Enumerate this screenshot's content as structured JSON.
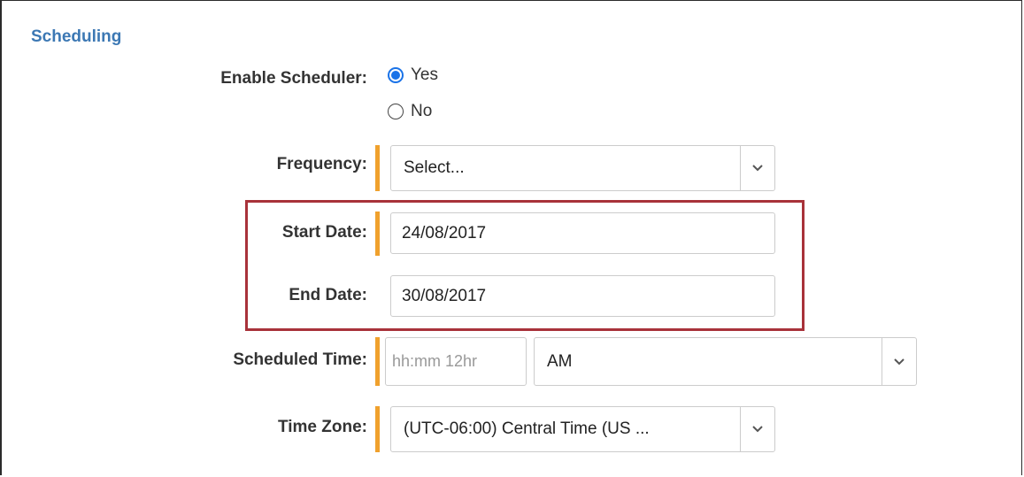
{
  "section": {
    "title": "Scheduling"
  },
  "enable_scheduler": {
    "label": "Enable Scheduler:",
    "options": [
      {
        "label": "Yes",
        "checked": true
      },
      {
        "label": "No",
        "checked": false
      }
    ]
  },
  "frequency": {
    "label": "Frequency:",
    "value": "Select..."
  },
  "start_date": {
    "label": "Start Date:",
    "value": "24/08/2017"
  },
  "end_date": {
    "label": "End Date:",
    "value": "30/08/2017"
  },
  "scheduled_time": {
    "label": "Scheduled Time:",
    "placeholder": "hh:mm 12hr",
    "ampm_value": "AM"
  },
  "time_zone": {
    "label": "Time Zone:",
    "value": "(UTC-06:00) Central Time (US ..."
  },
  "colors": {
    "section_title": "#3c78b4",
    "required_bar": "#f0a12d",
    "highlight_border": "#a8323a",
    "radio_accent": "#1a73e8"
  },
  "icons": {
    "dropdown": "chevron-down-icon"
  }
}
